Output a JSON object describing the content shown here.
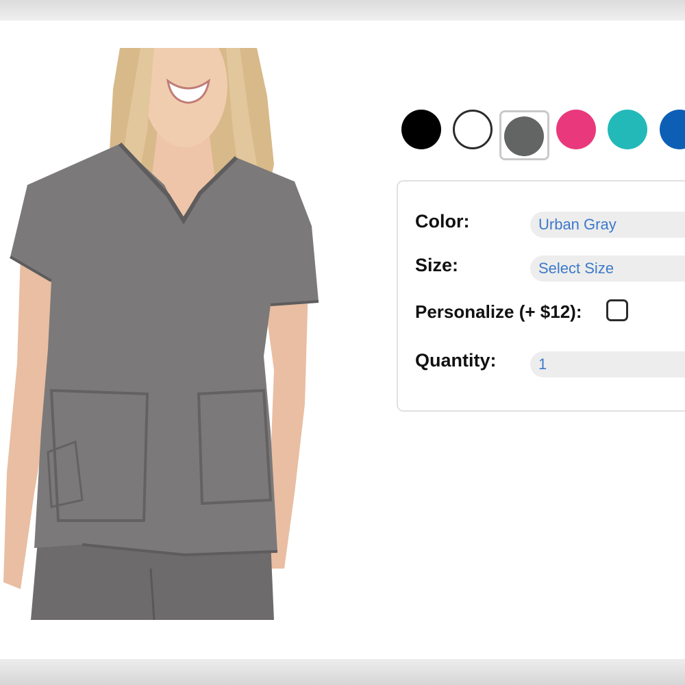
{
  "swatches": {
    "heading": "",
    "items": [
      {
        "name": "black",
        "color": "#000000"
      },
      {
        "name": "white",
        "color": "#ffffff"
      },
      {
        "name": "gray",
        "color": "#636464",
        "selected": true
      },
      {
        "name": "pink",
        "color": "#e9397c"
      },
      {
        "name": "teal",
        "color": "#23b9b9"
      },
      {
        "name": "blue",
        "color": "#0d5fb6"
      }
    ]
  },
  "options": {
    "color_label": "Color:",
    "color_value": "Urban Gray",
    "size_label": "Size:",
    "size_value": "Select Size",
    "personalize_label": "Personalize (+ $12):",
    "personalize_checked": false,
    "quantity_label": "Quantity:",
    "quantity_value": "1"
  },
  "colors": {
    "link_blue": "#3d79c9",
    "field_bg": "#ededed",
    "panel_border": "#e1e1e1"
  }
}
